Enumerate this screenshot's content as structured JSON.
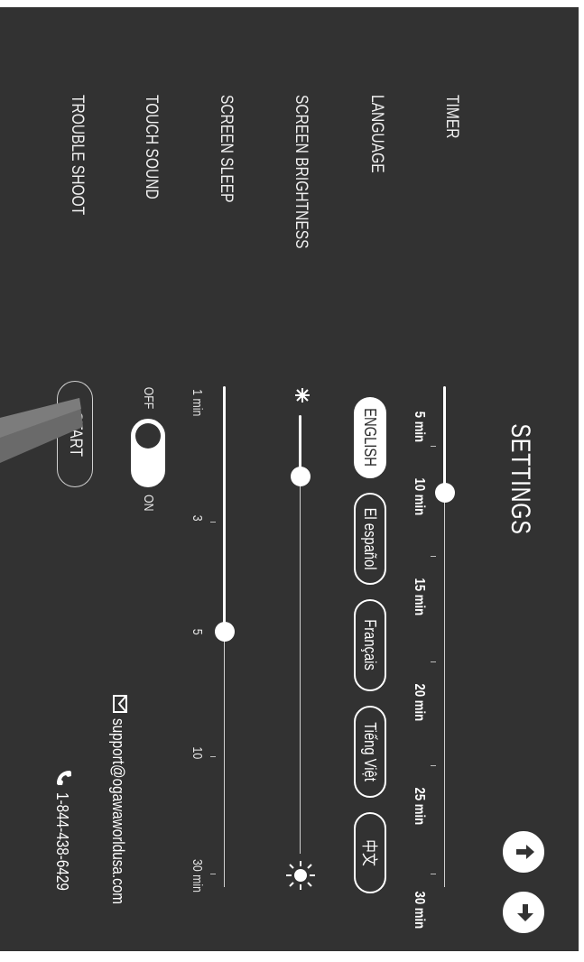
{
  "header": {
    "title": "SETTINGS"
  },
  "rows": {
    "timer": "TIMER",
    "language": "LANGUAGE",
    "brightness": "SCREEN BRIGHTNESS",
    "sleep": "SCREEN SLEEP",
    "touch_sound": "TOUCH SOUND",
    "trouble_shoot": "TROUBLE SHOOT"
  },
  "timer": {
    "ticks": [
      "5 min",
      "10 min",
      "15 min",
      "20 min",
      "25 min",
      "30 min"
    ],
    "selected": "10 min"
  },
  "language": {
    "options": [
      "ENGLISH",
      "El español",
      "Français",
      "Tiếng Việt",
      "中文"
    ],
    "selected": "ENGLISH"
  },
  "brightness": {
    "level": 0.14,
    "low_icon": "dim-sun-icon",
    "high_icon": "bright-sun-icon"
  },
  "sleep": {
    "ticks": [
      "1 min",
      "3",
      "5",
      "10",
      "30 min"
    ],
    "selected": "5"
  },
  "touch_sound": {
    "off_label": "OFF",
    "on_label": "ON",
    "state": "ON"
  },
  "trouble_shoot": {
    "button_label": "START"
  },
  "contact": {
    "email": "support@ogawaworldusa.com",
    "phone": "1-844-438-6429",
    "email_icon": "mail-icon",
    "phone_icon": "phone-icon"
  },
  "nav": {
    "up_icon": "arrow-up-icon",
    "exit_icon": "exit-arrow-icon"
  },
  "colors": {
    "background": "#323232",
    "foreground": "#ffffff"
  }
}
